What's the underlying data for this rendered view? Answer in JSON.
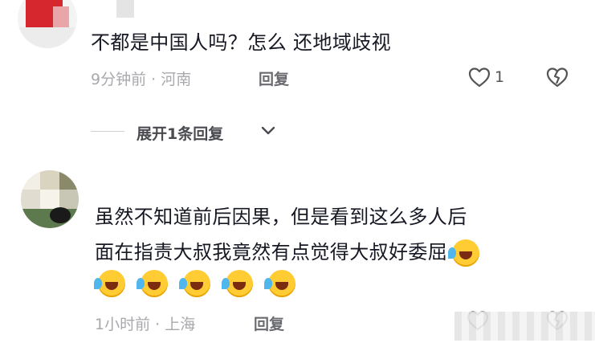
{
  "comment1": {
    "text": "不都是中国人吗？怎么 还地域歧视",
    "time_location": "9分钟前 · 河南",
    "reply_label": "回复",
    "like_count": "1"
  },
  "expand_replies": {
    "label": "展开1条回复"
  },
  "comment2": {
    "line1": "虽然不知道前后因果，但是看到这么多人后",
    "line2": "面在指责大叔我竟然有点觉得大叔好委屈",
    "time_location": "1小时前 · 上海",
    "reply_label": "回复"
  },
  "icons": {
    "like": "heart-outline-icon",
    "dislike": "broken-heart-icon",
    "expand": "chevron-down-icon",
    "emoji": "rolling-laughing-emoji"
  },
  "colors": {
    "text": "#161823",
    "meta": "#a8a9ad",
    "reply": "#6a6b70"
  }
}
